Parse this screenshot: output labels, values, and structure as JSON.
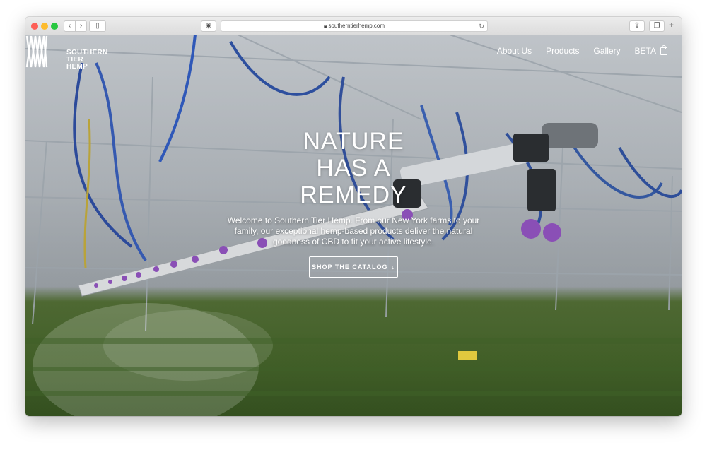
{
  "browser": {
    "url": "southerntierhemp.com",
    "icons": {
      "back": "chevron-left-icon",
      "forward": "chevron-right-icon",
      "sidebar": "sidebar-icon",
      "privacy": "shield-icon",
      "lock": "lock-icon",
      "reload": "reload-icon",
      "share": "share-icon",
      "tabs": "tabs-icon",
      "new_tab": "plus-icon"
    }
  },
  "brand": {
    "line1": "SOUTHERN",
    "line2": "TIER",
    "line3": "HEMP"
  },
  "nav": {
    "items": [
      "About Us",
      "Products",
      "Gallery"
    ],
    "beta": "BETA",
    "cart_icon": "shopping-bag-icon"
  },
  "hero": {
    "headline": [
      "NATURE",
      "HAS A",
      "REMEDY"
    ],
    "subtext": "Welcome to Southern Tier Hemp. From our New York farms to your family, our exceptional hemp-based products deliver the natural goodness of CBD to fit your active lifestyle.",
    "cta_label": "SHOP THE CATALOG",
    "cta_icon": "arrow-down-icon"
  },
  "colors": {
    "text_on_hero": "#ffffff",
    "greenhouse_sky": "#c9ced3",
    "plants": "#4f7230"
  }
}
